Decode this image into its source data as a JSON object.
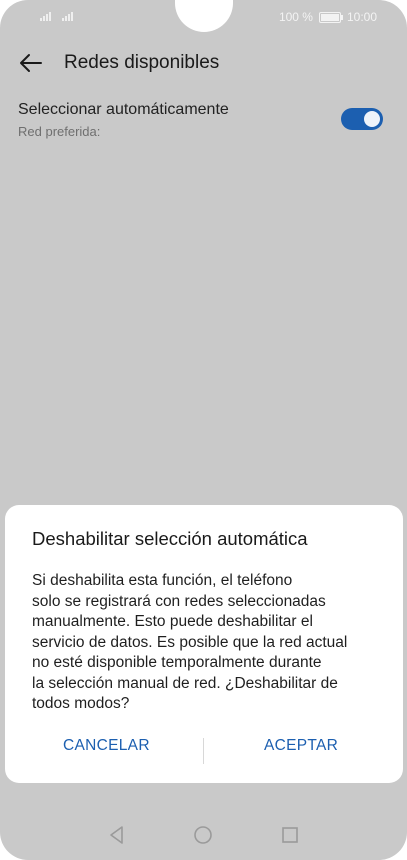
{
  "status_bar": {
    "battery_percent": "100 %",
    "time": "10:00"
  },
  "header": {
    "title": "Redes disponibles",
    "back_icon": "arrow-left-icon"
  },
  "setting": {
    "title": "Seleccionar automáticamente",
    "subtitle": "Red preferida:",
    "toggle_on": true,
    "accent": "#1c5fb0"
  },
  "dialog": {
    "title": "Deshabilitar selección automática",
    "message_lines": [
      "Si deshabilita esta función, el teléfono",
      "solo se registrará con redes seleccionadas",
      "manualmente. Esto puede deshabilitar el",
      "servicio de datos. Es posible que la red actual",
      "no esté disponible temporalmente durante",
      "la selección manual de red. ¿Deshabilitar de",
      "todos modos?"
    ],
    "cancel_label": "CANCELAR",
    "accept_label": "ACEPTAR"
  },
  "nav_bar": {
    "icons": [
      "triangle-back-icon",
      "circle-home-icon",
      "square-recent-icon"
    ]
  }
}
